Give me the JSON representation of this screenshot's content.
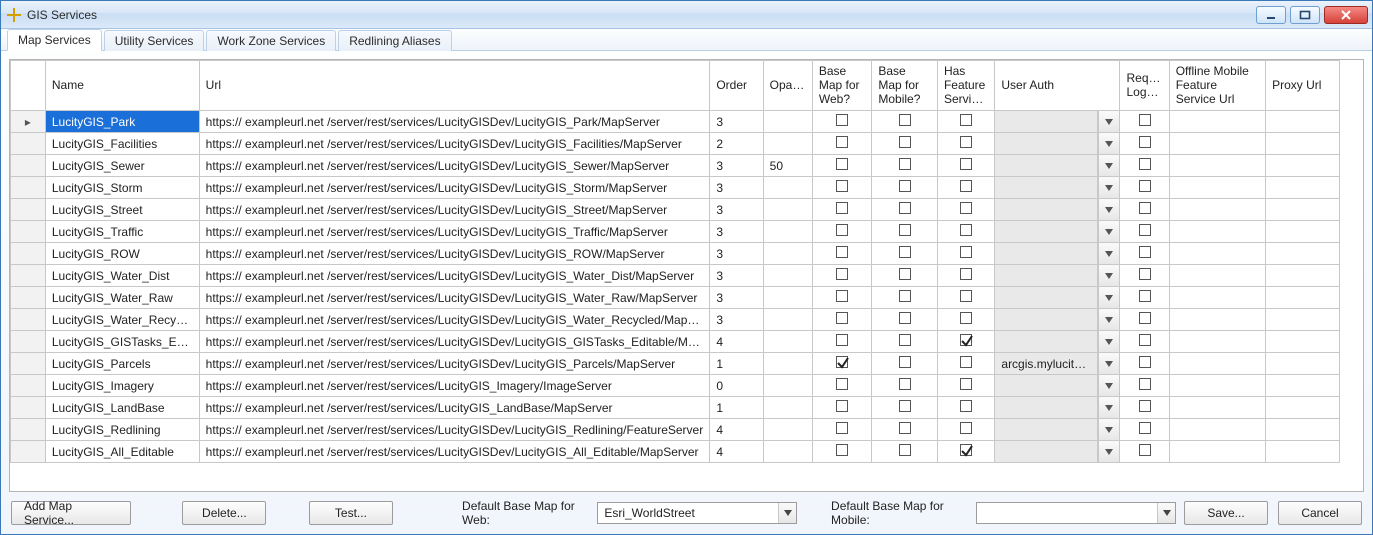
{
  "window": {
    "title": "GIS Services"
  },
  "tabs": [
    {
      "label": "Map Services",
      "active": true
    },
    {
      "label": "Utility Services"
    },
    {
      "label": "Work Zone Services"
    },
    {
      "label": "Redlining Aliases"
    }
  ],
  "columns": {
    "name": "Name",
    "url": "Url",
    "order": "Order",
    "opacity": "Opacity",
    "base_web": "Base Map for Web?",
    "base_mobile": "Base Map for Mobile?",
    "has_feature": "Has Feature Service?",
    "user_auth": "User Auth",
    "require_logon": "Require Logon?",
    "offline_url": "Offline Mobile Feature Service Url",
    "proxy_url": "Proxy Url"
  },
  "rows": [
    {
      "name": "LucityGIS_Park",
      "url": "https:// exampleurl.net /server/rest/services/LucityGISDev/LucityGIS_Park/MapServer",
      "order": "3",
      "opacity": "",
      "bweb": false,
      "bmob": false,
      "feat": false,
      "auth": "",
      "req": false,
      "off": "",
      "proxy": "",
      "selected": true,
      "current": true
    },
    {
      "name": "LucityGIS_Facilities",
      "url": "https:// exampleurl.net /server/rest/services/LucityGISDev/LucityGIS_Facilities/MapServer",
      "order": "2",
      "opacity": "",
      "bweb": false,
      "bmob": false,
      "feat": false,
      "auth": "",
      "req": false,
      "off": "",
      "proxy": ""
    },
    {
      "name": "LucityGIS_Sewer",
      "url": "https:// exampleurl.net /server/rest/services/LucityGISDev/LucityGIS_Sewer/MapServer",
      "order": "3",
      "opacity": "50",
      "bweb": false,
      "bmob": false,
      "feat": false,
      "auth": "",
      "req": false,
      "off": "",
      "proxy": ""
    },
    {
      "name": "LucityGIS_Storm",
      "url": "https:// exampleurl.net /server/rest/services/LucityGISDev/LucityGIS_Storm/MapServer",
      "order": "3",
      "opacity": "",
      "bweb": false,
      "bmob": false,
      "feat": false,
      "auth": "",
      "req": false,
      "off": "",
      "proxy": ""
    },
    {
      "name": "LucityGIS_Street",
      "url": "https:// exampleurl.net /server/rest/services/LucityGISDev/LucityGIS_Street/MapServer",
      "order": "3",
      "opacity": "",
      "bweb": false,
      "bmob": false,
      "feat": false,
      "auth": "",
      "req": false,
      "off": "",
      "proxy": ""
    },
    {
      "name": "LucityGIS_Traffic",
      "url": "https:// exampleurl.net /server/rest/services/LucityGISDev/LucityGIS_Traffic/MapServer",
      "order": "3",
      "opacity": "",
      "bweb": false,
      "bmob": false,
      "feat": false,
      "auth": "",
      "req": false,
      "off": "",
      "proxy": ""
    },
    {
      "name": "LucityGIS_ROW",
      "url": "https:// exampleurl.net /server/rest/services/LucityGISDev/LucityGIS_ROW/MapServer",
      "order": "3",
      "opacity": "",
      "bweb": false,
      "bmob": false,
      "feat": false,
      "auth": "",
      "req": false,
      "off": "",
      "proxy": ""
    },
    {
      "name": "LucityGIS_Water_Dist",
      "url": "https:// exampleurl.net /server/rest/services/LucityGISDev/LucityGIS_Water_Dist/MapServer",
      "order": "3",
      "opacity": "",
      "bweb": false,
      "bmob": false,
      "feat": false,
      "auth": "",
      "req": false,
      "off": "",
      "proxy": ""
    },
    {
      "name": "LucityGIS_Water_Raw",
      "url": "https:// exampleurl.net /server/rest/services/LucityGISDev/LucityGIS_Water_Raw/MapServer",
      "order": "3",
      "opacity": "",
      "bweb": false,
      "bmob": false,
      "feat": false,
      "auth": "",
      "req": false,
      "off": "",
      "proxy": ""
    },
    {
      "name": "LucityGIS_Water_Recycled",
      "url": "https:// exampleurl.net /server/rest/services/LucityGISDev/LucityGIS_Water_Recycled/MapServer",
      "order": "3",
      "opacity": "",
      "bweb": false,
      "bmob": false,
      "feat": false,
      "auth": "",
      "req": false,
      "off": "",
      "proxy": ""
    },
    {
      "name": "LucityGIS_GISTasks_Edita",
      "url": "https:// exampleurl.net /server/rest/services/LucityGISDev/LucityGIS_GISTasks_Editable/MapSer",
      "order": "4",
      "opacity": "",
      "bweb": false,
      "bmob": false,
      "feat": true,
      "auth": "",
      "req": false,
      "off": "",
      "proxy": ""
    },
    {
      "name": "LucityGIS_Parcels",
      "url": "https:// exampleurl.net /server/rest/services/LucityGISDev/LucityGIS_Parcels/MapServer",
      "order": "1",
      "opacity": "",
      "bweb": true,
      "bmob": false,
      "feat": false,
      "auth": "arcgis.mylucity.vie",
      "req": false,
      "off": "",
      "proxy": ""
    },
    {
      "name": "LucityGIS_Imagery",
      "url": "https:// exampleurl.net /server/rest/services/LucityGIS_Imagery/ImageServer",
      "order": "0",
      "opacity": "",
      "bweb": false,
      "bmob": false,
      "feat": false,
      "auth": "",
      "req": false,
      "off": "",
      "proxy": ""
    },
    {
      "name": "LucityGIS_LandBase",
      "url": "https:// exampleurl.net /server/rest/services/LucityGIS_LandBase/MapServer",
      "order": "1",
      "opacity": "",
      "bweb": false,
      "bmob": false,
      "feat": false,
      "auth": "",
      "req": false,
      "off": "",
      "proxy": ""
    },
    {
      "name": "LucityGIS_Redlining",
      "url": "https:// exampleurl.net /server/rest/services/LucityGISDev/LucityGIS_Redlining/FeatureServer",
      "order": "4",
      "opacity": "",
      "bweb": false,
      "bmob": false,
      "feat": false,
      "auth": "",
      "req": false,
      "off": "",
      "proxy": ""
    },
    {
      "name": "LucityGIS_All_Editable",
      "url": "https:// exampleurl.net /server/rest/services/LucityGISDev/LucityGIS_All_Editable/MapServer",
      "order": "4",
      "opacity": "",
      "bweb": false,
      "bmob": false,
      "feat": true,
      "auth": "",
      "req": false,
      "off": "",
      "proxy": ""
    }
  ],
  "footer": {
    "add": "Add Map Service...",
    "delete": "Delete...",
    "test": "Test...",
    "lbl_web": "Default Base Map for Web:",
    "combo_web": "Esri_WorldStreet",
    "lbl_mobile": "Default Base Map for Mobile:",
    "combo_mobile": "",
    "save": "Save...",
    "cancel": "Cancel"
  }
}
